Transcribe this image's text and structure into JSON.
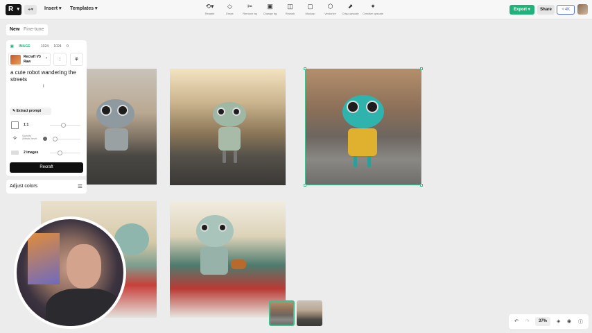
{
  "topbar": {
    "logo_label": "R",
    "menus": [
      {
        "label": "Insert"
      },
      {
        "label": "Templates"
      }
    ],
    "tools": [
      {
        "label": "Repaint",
        "icon": "lasso-icon"
      },
      {
        "label": "Erase",
        "icon": "eraser-icon"
      },
      {
        "label": "Remove bg",
        "icon": "scissors-icon"
      },
      {
        "label": "Change bg",
        "icon": "image-swap-icon"
      },
      {
        "label": "Rework",
        "icon": "rework-icon"
      },
      {
        "label": "Mockup",
        "icon": "mockup-icon"
      },
      {
        "label": "Vectorize",
        "icon": "vectorize-icon"
      },
      {
        "label": "Crisp upscale",
        "icon": "upscale-icon"
      },
      {
        "label": "Creative upscale",
        "icon": "creative-upscale-icon"
      }
    ],
    "export_label": "Export",
    "share_label": "Share",
    "credits_label": "4K"
  },
  "tabs": {
    "new_label": "New",
    "finetune_label": "Fine-tune"
  },
  "panel": {
    "meta": {
      "type_label": "IMAGE",
      "width": "1024",
      "height": "1024",
      "count": "0"
    },
    "model": {
      "name": "Recraft V3 Raw"
    },
    "prompt": "a cute robot wandering the streets",
    "extract_label": "Extract prompt",
    "aspect_label": "1:1",
    "artistic_label": "Specify Artistic level",
    "images_label": "2 images",
    "recraft_label": "Recraft",
    "adjust_label": "Adjust colors"
  },
  "canvas": {
    "selected_index": 2,
    "thumbnail_count": 2
  },
  "bottom": {
    "zoom": "37%"
  },
  "colors": {
    "accent": "#1fb37a",
    "selection": "#3fbf8e",
    "credits": "#4f6bd6"
  }
}
